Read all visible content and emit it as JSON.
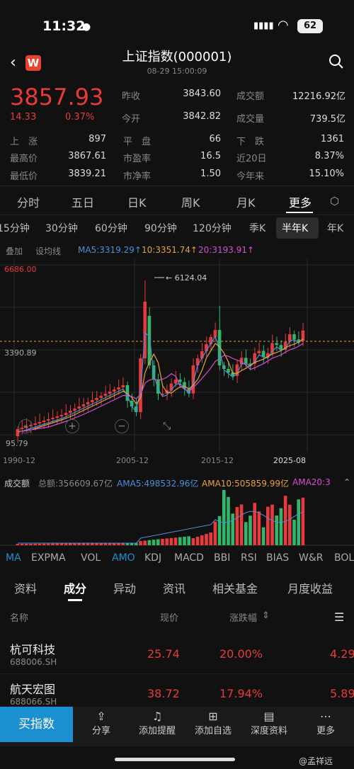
{
  "status": {
    "time": "11:32",
    "battery": "62"
  },
  "header": {
    "title": "上证指数(000001)",
    "subtitle": "08-29 15:00:09"
  },
  "quote": {
    "price": "3857.93",
    "change": "14.33",
    "change_pct": "0.37%",
    "fields": [
      {
        "label": "昨收",
        "value": "3843.60"
      },
      {
        "label": "成交额",
        "value": "12216.92亿"
      },
      {
        "label": "今开",
        "value": "3842.82"
      },
      {
        "label": "成交量",
        "value": "739.5亿"
      }
    ],
    "stats": [
      {
        "l1": "上　涨",
        "v1": "897",
        "l2": "平　盘",
        "v2": "66",
        "l3": "下　跌",
        "v3": "1361"
      },
      {
        "l1": "最高价",
        "v1": "3867.61",
        "l2": "市盈率",
        "v2": "16.5",
        "l3": "近20日",
        "v3": "8.37%"
      },
      {
        "l1": "最低价",
        "v1": "3839.21",
        "l2": "市净率",
        "v2": "1.50",
        "l3": "今年来",
        "v3": "15.10%"
      }
    ]
  },
  "period_tabs": [
    "分时",
    "五日",
    "日K",
    "周K",
    "月K",
    "更多"
  ],
  "period_active": "更多",
  "sub_tabs": [
    "15分钟",
    "30分钟",
    "60分钟",
    "90分钟",
    "120分钟",
    "季K",
    "半年K",
    "年K"
  ],
  "sub_active": "半年K",
  "ma_bar": {
    "overlay": "叠加",
    "draw": "设均线",
    "ma5": "MA5:3319.29↑",
    "ma10": "10:3351.74↑",
    "ma20": "20:3193.91↑"
  },
  "chart_data": {
    "type": "candlestick",
    "ymax_label": "6686.00",
    "ref_label": "3390.89",
    "min_label": "95.79",
    "peak_label": "6124.04",
    "x_labels": [
      "1990-12",
      "2005-12",
      "2015-12",
      "2025-08"
    ],
    "colors": {
      "up": "#e83a3a",
      "down": "#2fb86a",
      "ma5": "#4a90d9",
      "ma10": "#e8a33a",
      "ma20": "#d44fd4"
    }
  },
  "volume": {
    "label": "成交额",
    "total": "总额:356609.67亿",
    "ama5": "AMA5:498532.96亿",
    "ama10": "AMA10:505859.99亿",
    "ama20": "AMA20:3"
  },
  "indicators": [
    "MA",
    "EXPMA",
    "VOL",
    "AMO",
    "KDJ",
    "MACD",
    "BBI",
    "RSI",
    "BIAS",
    "W&R",
    "BOLL"
  ],
  "info_tabs": [
    "资料",
    "成分",
    "异动",
    "资讯",
    "相关基金",
    "月度收益"
  ],
  "info_active": "成分",
  "list_header": {
    "name": "名称",
    "price": "现价",
    "pct": "涨跌幅"
  },
  "stocks": [
    {
      "name": "杭可科技",
      "code": "688006.SH",
      "price": "25.74",
      "pct": "20.00%",
      "extra": "4.29"
    },
    {
      "name": "航天宏图",
      "code": "688066.SH",
      "price": "38.72",
      "pct": "17.94%",
      "extra": "5.89"
    }
  ],
  "bottom": {
    "buy": "买指数",
    "items": [
      "分享",
      "添加提醒",
      "添加自选",
      "深度资料",
      "更多"
    ]
  },
  "watermark": "@孟祥远"
}
